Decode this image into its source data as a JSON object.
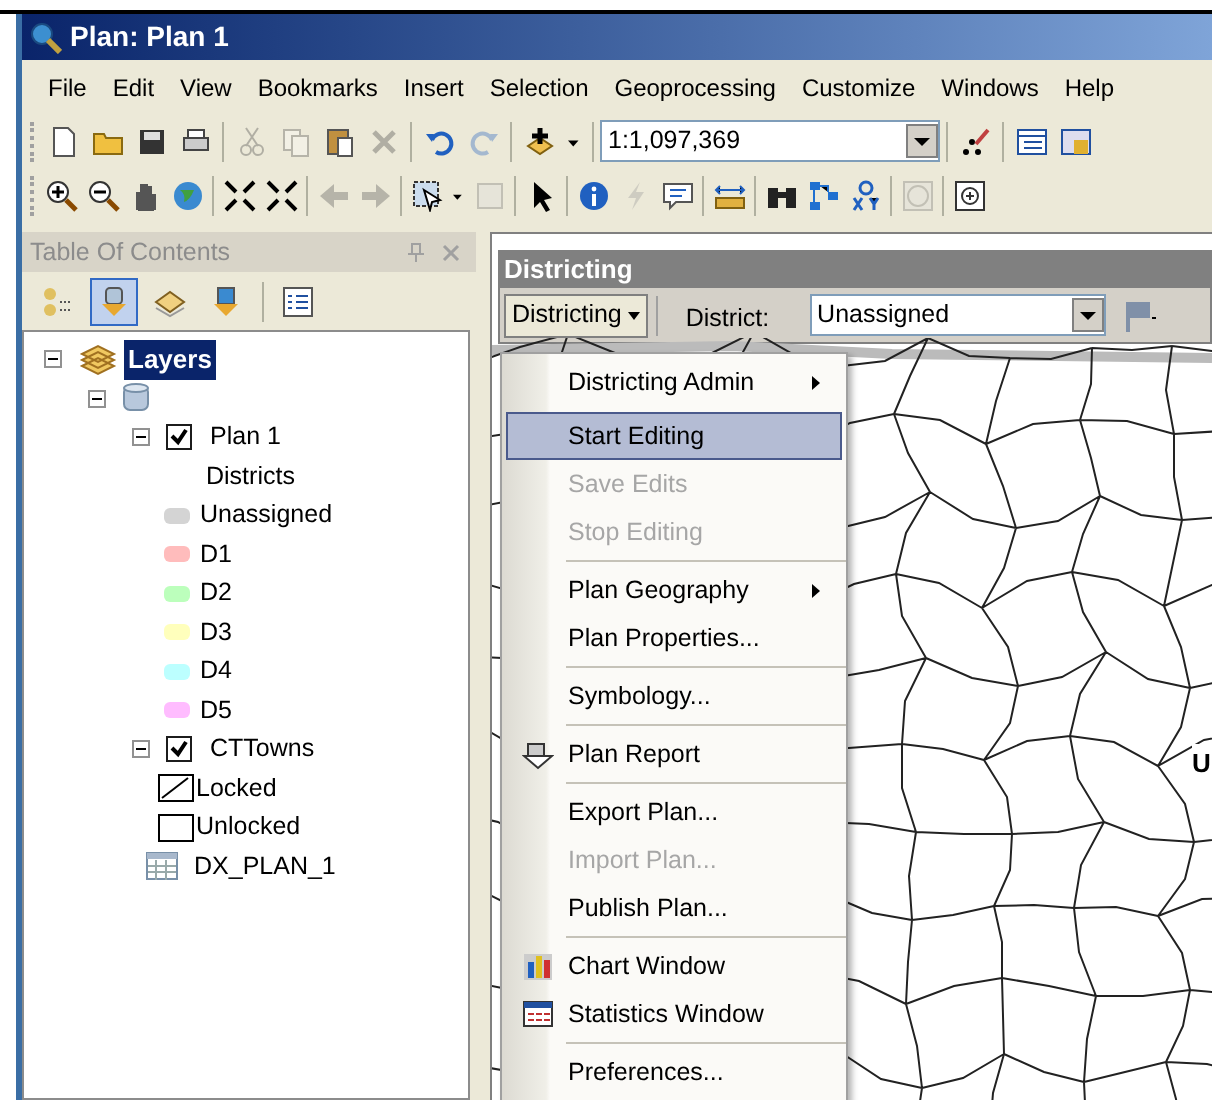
{
  "window": {
    "title": "Plan:  Plan 1"
  },
  "menu_bar": [
    "File",
    "Edit",
    "View",
    "Bookmarks",
    "Insert",
    "Selection",
    "Geoprocessing",
    "Customize",
    "Windows",
    "Help"
  ],
  "toolbar_1": [
    {
      "disabled": false
    },
    {
      "disabled": false
    },
    {
      "disabled": false
    },
    {
      "disabled": false
    },
    {
      "disabled": true
    },
    {
      "disabled": true
    },
    {
      "disabled": false
    },
    {
      "disabled": true
    },
    {
      "disabled": false
    },
    {
      "disabled": true
    },
    {
      "disabled": false
    },
    {
      "disabled": false
    },
    {
      "disabled": false
    },
    {
      "disabled": false
    }
  ],
  "scale_field": {
    "value": "1:1,097,369"
  },
  "toolbar_2": [
    {
      "disabled": false
    },
    {
      "disabled": false
    },
    {
      "disabled": false
    },
    {
      "disabled": false
    },
    {
      "disabled": false
    },
    {
      "disabled": false
    },
    {
      "disabled": true
    },
    {
      "disabled": true
    },
    {
      "disabled": false
    },
    {
      "disabled": false
    },
    {
      "disabled": true
    },
    {
      "disabled": false
    },
    {
      "disabled": false
    },
    {
      "disabled": true
    },
    {
      "disabled": false
    },
    {
      "disabled": false
    },
    {
      "disabled": false
    },
    {
      "disabled": false
    },
    {
      "disabled": false
    },
    {
      "disabled": true
    },
    {
      "disabled": false
    }
  ],
  "table_of_contents": {
    "title": "Table Of Contents",
    "tree": [
      {
        "kind": "layers",
        "label": "Layers",
        "selected": true,
        "expanded": true,
        "children": [
          {
            "kind": "database",
            "expanded": true,
            "children": [
              {
                "kind": "layer",
                "label": "Plan 1",
                "checked": true,
                "expanded": true,
                "children": [
                  {
                    "kind": "heading",
                    "label": "Districts"
                  },
                  {
                    "kind": "swatch",
                    "label": "Unassigned",
                    "color": "#d4d4d4"
                  },
                  {
                    "kind": "swatch",
                    "label": "D1",
                    "color": "#ffbcbc"
                  },
                  {
                    "kind": "swatch",
                    "label": "D2",
                    "color": "#bcffbc"
                  },
                  {
                    "kind": "swatch",
                    "label": "D3",
                    "color": "#ffffbc"
                  },
                  {
                    "kind": "swatch",
                    "label": "D4",
                    "color": "#bcffff"
                  },
                  {
                    "kind": "swatch",
                    "label": "D5",
                    "color": "#ffbcff"
                  }
                ]
              },
              {
                "kind": "layer",
                "label": "CTTowns",
                "checked": true,
                "expanded": true,
                "children": [
                  {
                    "kind": "hatched",
                    "label": "Locked"
                  },
                  {
                    "kind": "outline",
                    "label": "Unlocked"
                  }
                ]
              },
              {
                "kind": "table",
                "label": "DX_PLAN_1"
              }
            ]
          }
        ]
      }
    ]
  },
  "districting_toolbar": {
    "title": "Districting",
    "menu_button": "Districting",
    "district_label": "District:",
    "district_field": {
      "value": "Unassigned"
    }
  },
  "map": {
    "label": "U"
  },
  "menu": {
    "groups": [
      [
        {
          "label": "Districting Admin",
          "submenu": true,
          "disabled": false,
          "selected": false
        }
      ],
      [
        {
          "label": "Start Editing",
          "submenu": false,
          "disabled": false,
          "selected": true
        },
        {
          "label": "Save Edits",
          "submenu": false,
          "disabled": true,
          "selected": false
        },
        {
          "label": "Stop Editing",
          "submenu": false,
          "disabled": true,
          "selected": false
        }
      ],
      [
        {
          "label": "Plan Geography",
          "submenu": true,
          "disabled": false,
          "selected": false
        },
        {
          "label": "Plan Properties...",
          "submenu": false,
          "disabled": false,
          "selected": false
        }
      ],
      [
        {
          "label": "Symbology...",
          "submenu": false,
          "disabled": false,
          "selected": false
        }
      ],
      [
        {
          "label": "Plan Report",
          "submenu": false,
          "disabled": false,
          "selected": false,
          "has_icon": true
        }
      ],
      [
        {
          "label": "Export Plan...",
          "submenu": false,
          "disabled": false,
          "selected": false
        },
        {
          "label": "Import Plan...",
          "submenu": false,
          "disabled": true,
          "selected": false
        },
        {
          "label": "Publish Plan...",
          "submenu": false,
          "disabled": false,
          "selected": false
        }
      ],
      [
        {
          "label": "Chart Window",
          "submenu": false,
          "disabled": false,
          "selected": false,
          "has_icon": true
        },
        {
          "label": "Statistics Window",
          "submenu": false,
          "disabled": false,
          "selected": false,
          "has_icon": true
        }
      ],
      [
        {
          "label": "Preferences...",
          "submenu": false,
          "disabled": false,
          "selected": false
        }
      ]
    ]
  }
}
